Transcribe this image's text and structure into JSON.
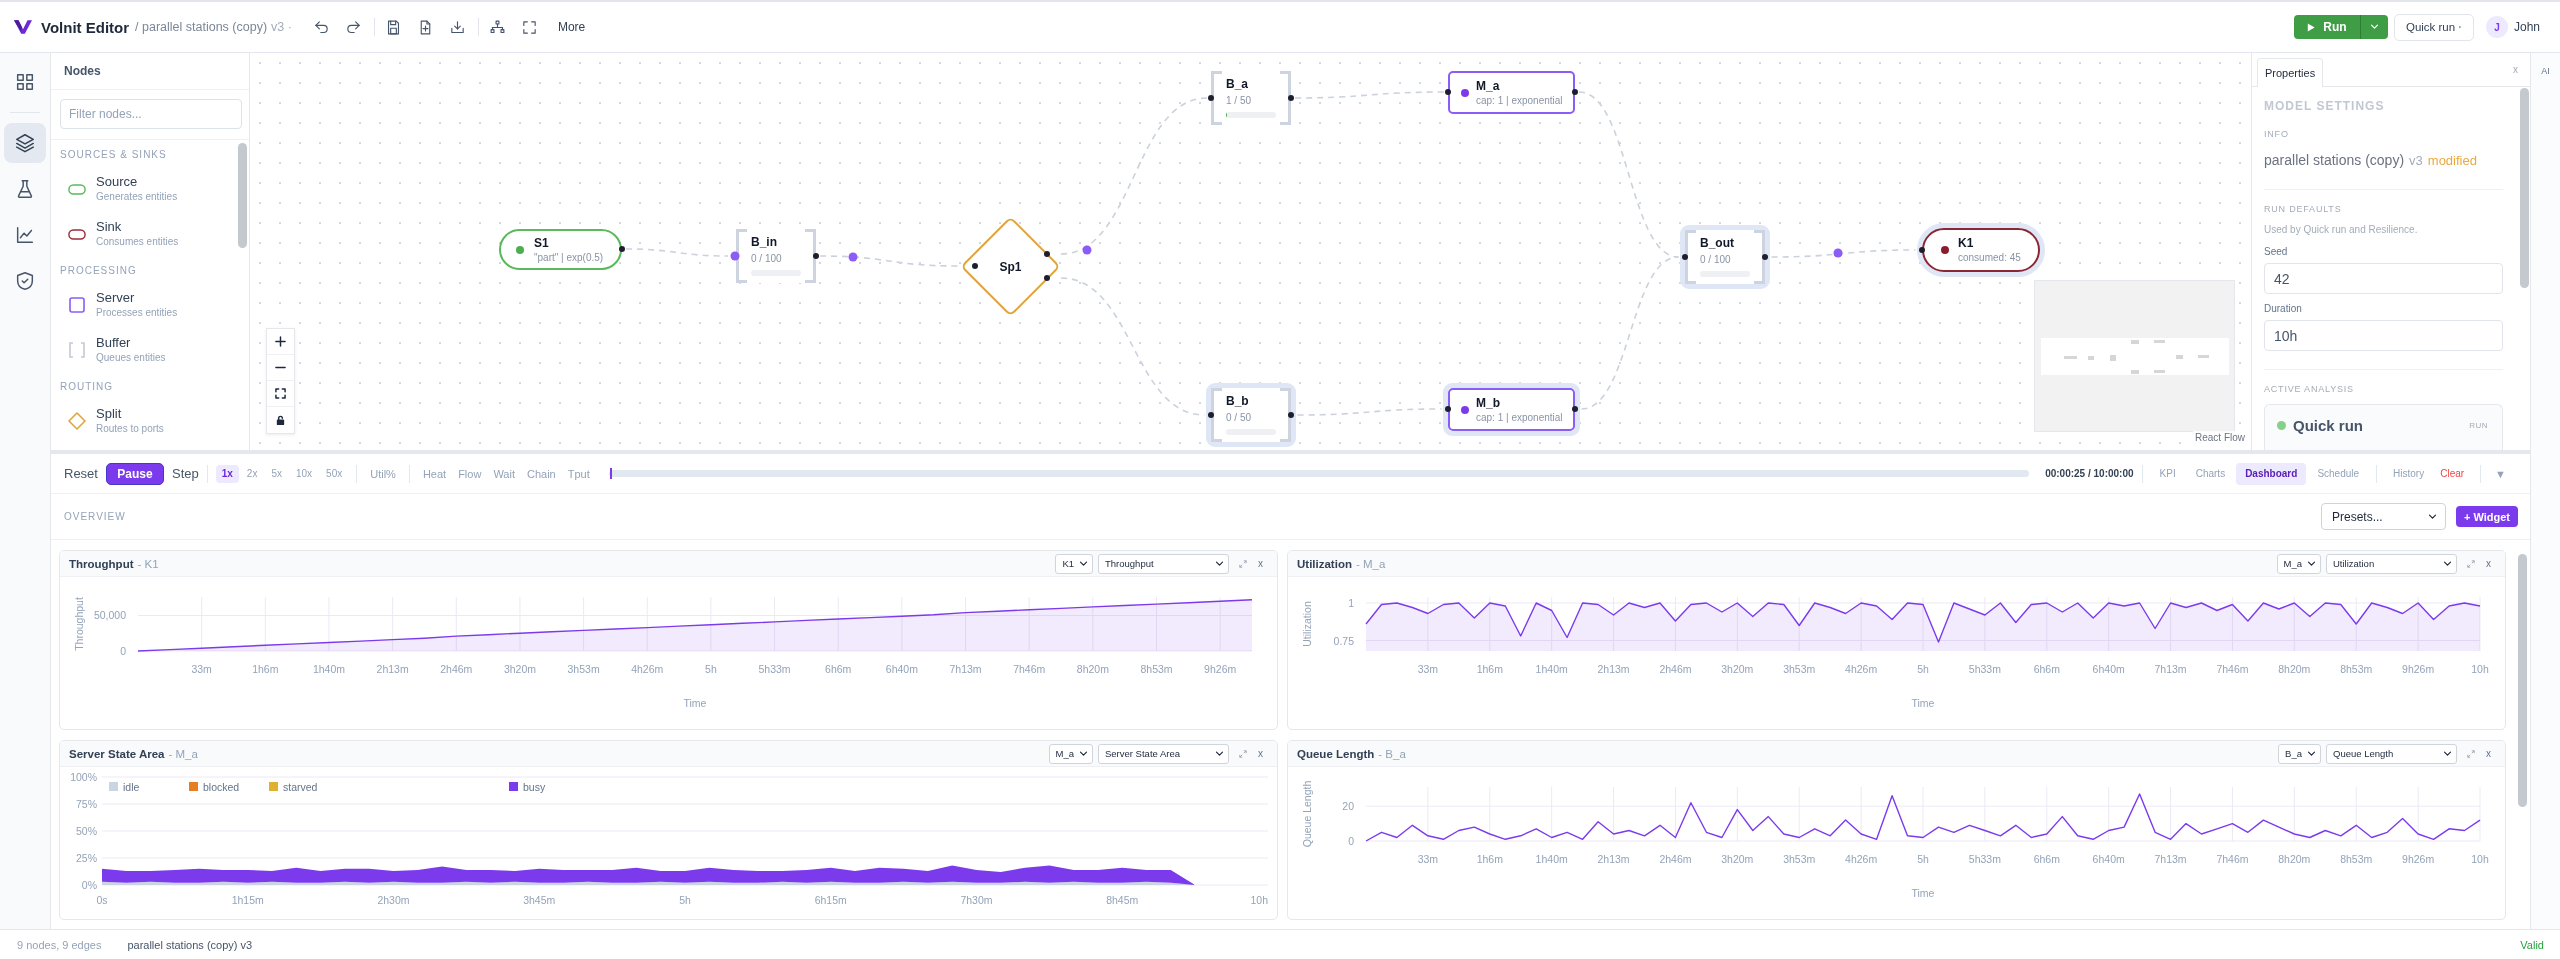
{
  "header": {
    "app_name": "Volnit Editor",
    "breadcrumb": "/ parallel stations (copy)",
    "version": "v3 ·",
    "more": "More",
    "run": "Run",
    "quick_run": {
      "label": "Quick run",
      "indicator": "·"
    },
    "user": {
      "initial": "J",
      "name": "John"
    }
  },
  "rail": {
    "items": [
      {
        "selected": false
      },
      {
        "selected": true
      },
      {
        "selected": false
      },
      {
        "selected": false
      },
      {
        "selected": false
      }
    ]
  },
  "nodes_panel": {
    "title": "Nodes",
    "filter": {
      "placeholder": "Filter nodes..."
    },
    "groups": [
      {
        "label": "SOURCES & SINKS",
        "items": [
          {
            "kind": "source",
            "name": "Source",
            "description": "Generates entities"
          },
          {
            "kind": "sink",
            "name": "Sink",
            "description": "Consumes entities"
          }
        ]
      },
      {
        "label": "PROCESSING",
        "items": [
          {
            "kind": "server",
            "name": "Server",
            "description": "Processes entities"
          },
          {
            "kind": "buffer",
            "name": "Buffer",
            "description": "Queues entities"
          }
        ]
      },
      {
        "label": "ROUTING",
        "items": [
          {
            "kind": "split",
            "name": "Split",
            "description": "Routes to ports"
          }
        ]
      }
    ]
  },
  "canvas": {
    "nodes": [
      {
        "kind": "source",
        "label": "S1",
        "detail": "\"part\" | exp(0.5)",
        "selected": false
      },
      {
        "kind": "buffer",
        "label": "B_in",
        "detail": "0 / 100",
        "selected": false
      },
      {
        "kind": "split",
        "label": "Sp1",
        "selected": false
      },
      {
        "kind": "buffer",
        "label": "B_a",
        "detail": "1 / 50",
        "level": 0.02,
        "selected": false
      },
      {
        "kind": "server",
        "label": "M_a",
        "detail": "cap: 1 | exponential",
        "selected": false
      },
      {
        "kind": "buffer",
        "label": "B_b",
        "detail": "0 / 50",
        "selected": true
      },
      {
        "kind": "server",
        "label": "M_b",
        "detail": "cap: 1 | exponential",
        "selected": true
      },
      {
        "kind": "buffer",
        "label": "B_out",
        "detail": "0 / 100",
        "selected": true
      },
      {
        "kind": "sink",
        "label": "K1",
        "detail": "consumed: 45",
        "selected": true
      }
    ],
    "attribution": "React Flow"
  },
  "properties": {
    "tabs": [
      {
        "label": "Properties",
        "selected": true
      }
    ],
    "close": "x",
    "heading": "MODEL SETTINGS",
    "info": {
      "label": "INFO",
      "name": "parallel stations (copy)",
      "version": "v3",
      "status": "modified"
    },
    "run_defaults": {
      "label": "RUN DEFAULTS",
      "hint": "Used by Quick run and Resilience.",
      "fields": [
        {
          "label": "Seed",
          "value": "42"
        },
        {
          "label": "Duration",
          "value": "10h"
        }
      ]
    },
    "active_analysis": {
      "label": "ACTIVE ANALYSIS",
      "name": "Quick run",
      "badge": "RUN"
    }
  },
  "ai_panel": {
    "label": "AI"
  },
  "playback": {
    "controls": [
      {
        "kind": "plain",
        "label": "Reset"
      },
      {
        "kind": "primary",
        "label": "Pause"
      },
      {
        "kind": "plain",
        "label": "Step"
      }
    ],
    "speeds": [
      {
        "label": "1x",
        "selected": true
      },
      {
        "label": "2x",
        "selected": false
      },
      {
        "label": "5x",
        "selected": false
      },
      {
        "label": "10x",
        "selected": false
      },
      {
        "label": "50x",
        "selected": false
      }
    ],
    "overlays": [
      {
        "label": "Util%",
        "selected": false
      }
    ],
    "views": [
      {
        "label": "Heat",
        "selected": false
      },
      {
        "label": "Flow",
        "selected": false
      },
      {
        "label": "Wait",
        "selected": false
      },
      {
        "label": "Chain",
        "selected": false
      },
      {
        "label": "Tput",
        "selected": false
      }
    ],
    "progress": {
      "level": 0.0007
    },
    "time": "00:00:25 / 10:00:00",
    "tabs": [
      {
        "label": "KPI",
        "selected": false
      },
      {
        "label": "Charts",
        "selected": false
      },
      {
        "label": "Dashboard",
        "selected": true
      },
      {
        "label": "Schedule",
        "selected": false
      }
    ],
    "actions": [
      {
        "kind": "plain",
        "label": "History"
      },
      {
        "kind": "danger",
        "label": "Clear"
      }
    ],
    "collapse": "▼"
  },
  "dashboard": {
    "section": "OVERVIEW",
    "presets": "Presets...",
    "add_widget": "+ Widget",
    "widgets": [
      {
        "title": "Throughput",
        "subject": "- K1",
        "node": "K1",
        "metric": "Throughput",
        "close": "x",
        "chart_data": {
          "type": "area",
          "grid": true,
          "xlabel": "Time",
          "ylabel": "Throughput",
          "categories": [
            null,
            null,
            "33m",
            null,
            "1h6m",
            null,
            "1h40m",
            null,
            "2h13m",
            null,
            "2h46m",
            null,
            "3h20m",
            null,
            "3h53m",
            null,
            "4h26m",
            null,
            "5h",
            null,
            "5h33m",
            null,
            "6h6m",
            null,
            "6h40m",
            null,
            "7h13m",
            null,
            "7h46m",
            null,
            "8h20m",
            null,
            "8h53m",
            null,
            "9h26m",
            null
          ],
          "values": [
            0,
            2000,
            4000,
            6000,
            8000,
            10000,
            12000,
            14000,
            16000,
            18000,
            21000,
            23000,
            25000,
            27000,
            29000,
            31000,
            33000,
            35000,
            37000,
            39000,
            41000,
            43000,
            45000,
            47000,
            49000,
            51000,
            54000,
            56000,
            58000,
            60000,
            62000,
            64000,
            66000,
            68000,
            70000,
            72000
          ],
          "ylim": [
            0,
            76000
          ],
          "yticks": [
            0,
            {
              "value": 50000,
              "label": "50,000"
            }
          ]
        }
      },
      {
        "title": "Utilization",
        "subject": "- M_a",
        "node": "M_a",
        "metric": "Utilization",
        "close": "x",
        "chart_data": {
          "type": "area",
          "grid": true,
          "xlabel": "Time",
          "ylabel": "Utilization",
          "categories": [
            null,
            null,
            null,
            null,
            "33m",
            null,
            null,
            null,
            "1h6m",
            null,
            null,
            null,
            "1h40m",
            null,
            null,
            null,
            "2h13m",
            null,
            null,
            null,
            "2h46m",
            null,
            null,
            null,
            "3h20m",
            null,
            null,
            null,
            "3h53m",
            null,
            null,
            null,
            "4h26m",
            null,
            null,
            null,
            "5h",
            null,
            null,
            null,
            "5h33m",
            null,
            null,
            null,
            "6h6m",
            null,
            null,
            null,
            "6h40m",
            null,
            null,
            null,
            "7h13m",
            null,
            null,
            null,
            "7h46m",
            null,
            null,
            null,
            "8h20m",
            null,
            null,
            null,
            "8h53m",
            null,
            null,
            null,
            "9h26m",
            null,
            null,
            null,
            "10h"
          ],
          "values": [
            0.86,
            0.99,
            1,
            0.97,
            0.93,
            0.99,
            1,
            0.9,
            1,
            0.98,
            0.78,
            1,
            0.95,
            0.77,
            1,
            0.99,
            0.92,
            1,
            0.97,
            1,
            0.88,
            0.99,
            1,
            0.94,
            1,
            0.91,
            1,
            0.99,
            0.85,
            1,
            0.97,
            0.93,
            1,
            0.98,
            0.89,
            1,
            0.99,
            0.74,
            1,
            0.96,
            0.92,
            1,
            0.87,
            0.99,
            1,
            0.94,
            1,
            0.9,
            1,
            0.98,
            1,
            0.83,
            1,
            0.97,
            1,
            0.95,
            0.99,
            0.88,
            1,
            0.96,
            1,
            0.91,
            1,
            0.99,
            0.86,
            1,
            0.97,
            0.93,
            1,
            0.89,
            0.98,
            1,
            0.98
          ],
          "ylim": [
            0.68,
            1.04
          ],
          "yticks": [
            0.75,
            1
          ]
        }
      },
      {
        "title": "Server State Area",
        "subject": "- M_a",
        "node": "M_a",
        "metric": "Server State Area",
        "close": "x",
        "chart_data": {
          "type": "area",
          "stacked": true,
          "grid": true,
          "legend": true,
          "categories": [
            "0s",
            null,
            null,
            null,
            null,
            null,
            "1h15m",
            null,
            null,
            null,
            null,
            null,
            "2h30m",
            null,
            null,
            null,
            null,
            null,
            "3h45m",
            null,
            null,
            null,
            null,
            null,
            "5h",
            null,
            null,
            null,
            null,
            null,
            "6h15m",
            null,
            null,
            null,
            null,
            null,
            "7h30m",
            null,
            null,
            null,
            null,
            null,
            "8h45m",
            null,
            null,
            null,
            null,
            null,
            "10h"
          ],
          "series": [
            {
              "name": "idle",
              "color": "#cbd5e1",
              "values": [
                3,
                2,
                3,
                2,
                2,
                3,
                2,
                3,
                2,
                2,
                3,
                2,
                3,
                2,
                2,
                3,
                2,
                3,
                2,
                2,
                3,
                2,
                2,
                3,
                2,
                3,
                2,
                2,
                3,
                2,
                3,
                2,
                2,
                3,
                2,
                3,
                2,
                2,
                3,
                2,
                3,
                2,
                2,
                3,
                2,
                0,
                null,
                null,
                null
              ]
            },
            {
              "name": "blocked",
              "color": "#e67e22",
              "values": [
                null,
                null,
                null,
                null,
                null,
                null,
                null,
                null,
                null,
                null,
                null,
                null,
                null,
                null,
                null,
                null,
                null,
                null,
                null,
                null,
                null,
                null,
                null,
                null,
                null,
                null,
                null,
                null,
                null,
                null,
                null,
                null,
                null,
                null,
                null,
                null,
                null,
                null,
                null,
                null,
                null,
                null,
                null,
                null,
                null,
                null,
                null,
                null,
                null
              ]
            },
            {
              "name": "starved",
              "color": "#e0b030",
              "values": [
                null,
                null,
                null,
                null,
                null,
                null,
                null,
                null,
                null,
                null,
                null,
                null,
                null,
                null,
                null,
                null,
                null,
                null,
                null,
                null,
                null,
                null,
                null,
                null,
                null,
                null,
                null,
                null,
                null,
                null,
                null,
                null,
                null,
                null,
                null,
                null,
                null,
                null,
                null,
                null,
                null,
                null,
                null,
                null,
                null,
                null,
                null,
                null,
                null
              ]
            },
            {
              "name": "busy",
              "color": "#7c3aed",
              "values": [
                12,
                11,
                10,
                12,
                13,
                11,
                12,
                10,
                14,
                11,
                12,
                13,
                10,
                12,
                15,
                11,
                12,
                10,
                13,
                12,
                11,
                12,
                14,
                10,
                11,
                13,
                12,
                11,
                10,
                12,
                13,
                11,
                14,
                12,
                11,
                15,
                12,
                10,
                13,
                16,
                11,
                12,
                14,
                11,
                12,
                0,
                null,
                null,
                null
              ]
            }
          ],
          "ylim": [
            0,
            100
          ],
          "yticks": [
            {
              "value": 0,
              "label": "0%"
            },
            {
              "value": 25,
              "label": "25%"
            },
            {
              "value": 50,
              "label": "50%"
            },
            {
              "value": 75,
              "label": "75%"
            },
            {
              "value": 100,
              "label": "100%"
            }
          ]
        }
      },
      {
        "title": "Queue Length",
        "subject": "- B_a",
        "node": "B_a",
        "metric": "Queue Length",
        "close": "x",
        "chart_data": {
          "type": "line",
          "grid": true,
          "xlabel": "Time",
          "ylabel": "Queue Length",
          "categories": [
            null,
            null,
            null,
            null,
            "33m",
            null,
            null,
            null,
            "1h6m",
            null,
            null,
            null,
            "1h40m",
            null,
            null,
            null,
            "2h13m",
            null,
            null,
            null,
            "2h46m",
            null,
            null,
            null,
            "3h20m",
            null,
            null,
            null,
            "3h53m",
            null,
            null,
            null,
            "4h26m",
            null,
            null,
            null,
            "5h",
            null,
            null,
            null,
            "5h33m",
            null,
            null,
            null,
            "6h6m",
            null,
            null,
            null,
            "6h40m",
            null,
            null,
            null,
            "7h13m",
            null,
            null,
            null,
            "7h46m",
            null,
            null,
            null,
            "8h20m",
            null,
            null,
            null,
            "8h53m",
            null,
            null,
            null,
            "9h26m",
            null,
            null,
            null,
            "10h"
          ],
          "values": [
            0,
            5,
            2,
            9,
            3,
            1,
            6,
            8,
            4,
            1,
            3,
            7,
            2,
            5,
            1,
            11,
            4,
            6,
            3,
            9,
            2,
            22,
            5,
            2,
            18,
            6,
            14,
            4,
            2,
            7,
            3,
            12,
            4,
            1,
            26,
            3,
            2,
            8,
            5,
            9,
            6,
            3,
            9,
            2,
            4,
            14,
            3,
            1,
            6,
            8,
            27,
            5,
            1,
            10,
            4,
            7,
            10,
            5,
            12,
            8,
            4,
            2,
            6,
            3,
            9,
            2,
            5,
            13,
            4,
            1,
            7,
            6,
            12
          ],
          "ylim": [
            0,
            31
          ],
          "yticks": [
            0,
            20
          ]
        }
      }
    ]
  },
  "status_bar": {
    "counts": "9 nodes, 9 edges",
    "model": "parallel stations (copy) v3",
    "validity": "Valid"
  }
}
